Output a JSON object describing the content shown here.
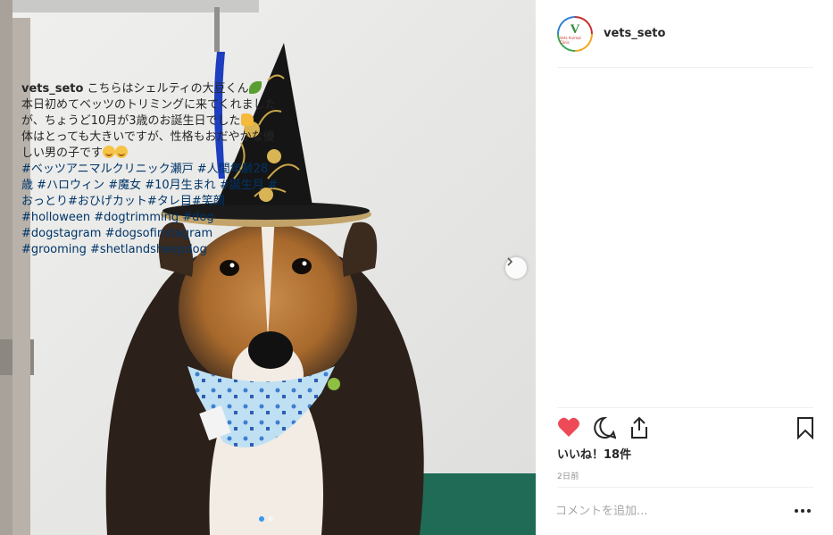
{
  "post": {
    "username": "vets_seto",
    "avatar_letter": "V",
    "avatar_text": "Vets Animal Clinic",
    "caption_user": "vets_seto",
    "caption_lines": [
      "こちらはシェルティの大豆くん",
      "本日初めてベッツのトリミングに来てくれましたが、ちょうど10月が3歳のお誕生日でした",
      "体はとっても大きいですが、性格もおだやかな優しい男の子です"
    ],
    "hashtags": [
      "#ベッツアニマルクリニック瀬戸",
      "#人間年齢28歳",
      "#ハロウィン",
      "#魔女",
      "#10月生まれ",
      "#誕生月",
      "#おっとり",
      "#おひげカット",
      "#タレ目",
      "#笑顔",
      "#holloween",
      "#dogtrimming",
      "#dog",
      "#dogstagram",
      "#dogsofinstagram",
      "#grooming",
      "#shetlandsheepdog"
    ],
    "likes_label": "いいね！18件",
    "time_label": "2日前",
    "comment_placeholder": "コメントを追加...",
    "photo_alt": "Shetland sheepdog wearing a witch hat",
    "carousel": {
      "count": 2,
      "active": 0
    }
  },
  "colors": {
    "heart": "#ed4956",
    "hashtag": "#003569",
    "carousel_active": "#3897f0",
    "muted": "#8e8e8e"
  },
  "icons": {
    "like": "heart-icon",
    "comment": "comment-icon",
    "share": "share-icon",
    "save": "bookmark-icon",
    "next": "chevron-right-icon",
    "more": "more-options-icon"
  }
}
